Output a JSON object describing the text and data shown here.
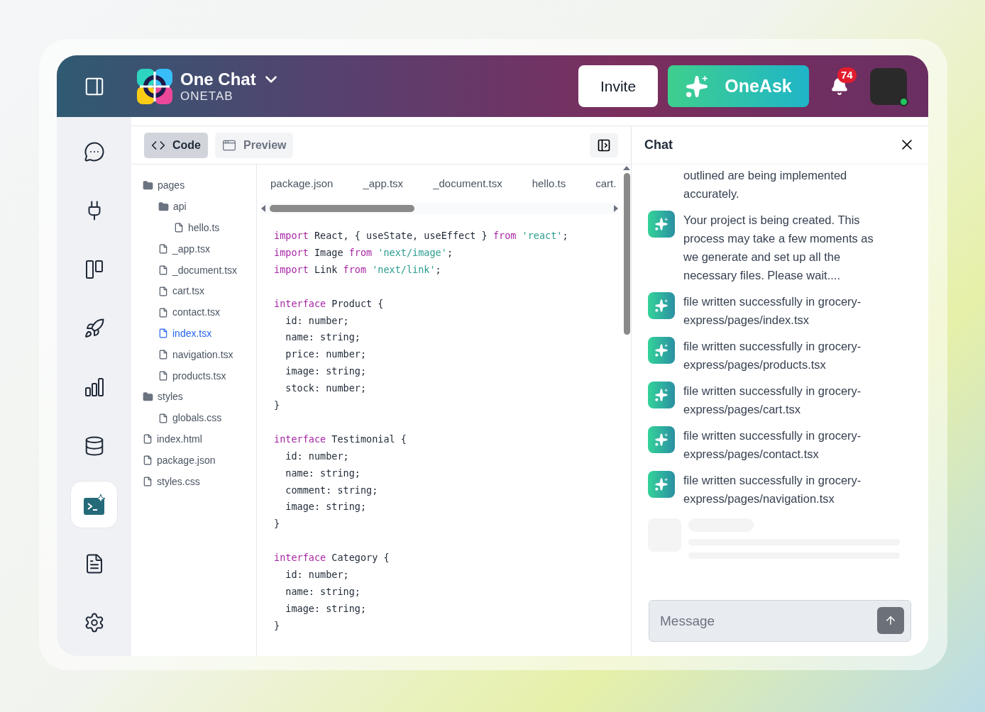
{
  "header": {
    "app_name": "One Chat",
    "workspace": "ONETAB",
    "invite_label": "Invite",
    "oneask_label": "OneAsk",
    "notification_count": "74"
  },
  "sidebar": {
    "items": [
      {
        "selected": false
      },
      {
        "selected": false
      },
      {
        "selected": false
      },
      {
        "selected": false
      },
      {
        "selected": false
      },
      {
        "selected": false
      },
      {
        "selected": true
      },
      {
        "selected": false
      },
      {
        "selected": false
      }
    ]
  },
  "view_tabs": [
    {
      "label": "Code",
      "selected": true
    },
    {
      "label": "Preview",
      "selected": false
    }
  ],
  "file_tree": [
    {
      "kind": "folder",
      "name": "pages",
      "selected": false,
      "children": [
        {
          "kind": "folder",
          "name": "api",
          "selected": false,
          "children": [
            {
              "kind": "file",
              "name": "hello.ts",
              "selected": false
            }
          ]
        },
        {
          "kind": "file",
          "name": "_app.tsx",
          "selected": false
        },
        {
          "kind": "file",
          "name": "_document.tsx",
          "selected": false
        },
        {
          "kind": "file",
          "name": "cart.tsx",
          "selected": false
        },
        {
          "kind": "file",
          "name": "contact.tsx",
          "selected": false
        },
        {
          "kind": "file",
          "name": "index.tsx",
          "selected": true
        },
        {
          "kind": "file",
          "name": "navigation.tsx",
          "selected": false
        },
        {
          "kind": "file",
          "name": "products.tsx",
          "selected": false
        }
      ]
    },
    {
      "kind": "folder",
      "name": "styles",
      "selected": false,
      "children": [
        {
          "kind": "file",
          "name": "globals.css",
          "selected": false
        }
      ]
    },
    {
      "kind": "file",
      "name": "index.html",
      "selected": false
    },
    {
      "kind": "file",
      "name": "package.json",
      "selected": false
    },
    {
      "kind": "file",
      "name": "styles.css",
      "selected": false
    }
  ],
  "editor_tabs": [
    "package.json",
    "_app.tsx",
    "_document.tsx",
    "hello.ts",
    "cart."
  ],
  "code_lines": [
    {
      "kind": "code",
      "tokens": [
        {
          "kind": "keyword",
          "text": "import"
        },
        {
          "kind": "plain",
          "text": " React, { useState, useEffect } "
        },
        {
          "kind": "keyword",
          "text": "from "
        },
        {
          "kind": "string",
          "text": "'react'"
        },
        {
          "kind": "plain",
          "text": ";"
        }
      ]
    },
    {
      "kind": "code",
      "tokens": [
        {
          "kind": "keyword",
          "text": "import"
        },
        {
          "kind": "plain",
          "text": " Image "
        },
        {
          "kind": "keyword",
          "text": "from "
        },
        {
          "kind": "string",
          "text": "'next/image'"
        },
        {
          "kind": "plain",
          "text": ";"
        }
      ]
    },
    {
      "kind": "code",
      "tokens": [
        {
          "kind": "keyword",
          "text": "import"
        },
        {
          "kind": "plain",
          "text": " Link "
        },
        {
          "kind": "keyword",
          "text": "from "
        },
        {
          "kind": "string",
          "text": "'next/link'"
        },
        {
          "kind": "plain",
          "text": ";"
        }
      ]
    },
    {
      "kind": "blank"
    },
    {
      "kind": "code",
      "tokens": [
        {
          "kind": "keyword",
          "text": "interface"
        },
        {
          "kind": "plain",
          "text": " Product {"
        }
      ]
    },
    {
      "kind": "code",
      "tokens": [
        {
          "kind": "plain",
          "text": "  id: number;"
        }
      ]
    },
    {
      "kind": "code",
      "tokens": [
        {
          "kind": "plain",
          "text": "  name: string;"
        }
      ]
    },
    {
      "kind": "code",
      "tokens": [
        {
          "kind": "plain",
          "text": "  price: number;"
        }
      ]
    },
    {
      "kind": "code",
      "tokens": [
        {
          "kind": "plain",
          "text": "  image: string;"
        }
      ]
    },
    {
      "kind": "code",
      "tokens": [
        {
          "kind": "plain",
          "text": "  stock: number;"
        }
      ]
    },
    {
      "kind": "code",
      "tokens": [
        {
          "kind": "plain",
          "text": "}"
        }
      ]
    },
    {
      "kind": "blank"
    },
    {
      "kind": "code",
      "tokens": [
        {
          "kind": "keyword",
          "text": "interface"
        },
        {
          "kind": "plain",
          "text": " Testimonial {"
        }
      ]
    },
    {
      "kind": "code",
      "tokens": [
        {
          "kind": "plain",
          "text": "  id: number;"
        }
      ]
    },
    {
      "kind": "code",
      "tokens": [
        {
          "kind": "plain",
          "text": "  name: string;"
        }
      ]
    },
    {
      "kind": "code",
      "tokens": [
        {
          "kind": "plain",
          "text": "  comment: string;"
        }
      ]
    },
    {
      "kind": "code",
      "tokens": [
        {
          "kind": "plain",
          "text": "  image: string;"
        }
      ]
    },
    {
      "kind": "code",
      "tokens": [
        {
          "kind": "plain",
          "text": "}"
        }
      ]
    },
    {
      "kind": "blank"
    },
    {
      "kind": "code",
      "tokens": [
        {
          "kind": "keyword",
          "text": "interface"
        },
        {
          "kind": "plain",
          "text": " Category {"
        }
      ]
    },
    {
      "kind": "code",
      "tokens": [
        {
          "kind": "plain",
          "text": "  id: number;"
        }
      ]
    },
    {
      "kind": "code",
      "tokens": [
        {
          "kind": "plain",
          "text": "  name: string;"
        }
      ]
    },
    {
      "kind": "code",
      "tokens": [
        {
          "kind": "plain",
          "text": "  image: string;"
        }
      ]
    },
    {
      "kind": "code",
      "tokens": [
        {
          "kind": "plain",
          "text": "}"
        }
      ]
    }
  ],
  "chat": {
    "title": "Chat",
    "messages": [
      {
        "avatar": false,
        "text": "outlined are being implemented accurately."
      },
      {
        "avatar": true,
        "text": "Your project is being created. This process may take a few moments as we generate and set up all the necessary files. Please wait...."
      },
      {
        "avatar": true,
        "text": "file written successfully in grocery-express/pages/index.tsx"
      },
      {
        "avatar": true,
        "text": "file written successfully in grocery-express/pages/products.tsx"
      },
      {
        "avatar": true,
        "text": "file written successfully in grocery-express/pages/cart.tsx"
      },
      {
        "avatar": true,
        "text": "file written successfully in grocery-express/pages/contact.tsx"
      },
      {
        "avatar": true,
        "text": "file written successfully in grocery-express/pages/navigation.tsx"
      }
    ],
    "loading": true,
    "input_placeholder": "Message"
  }
}
